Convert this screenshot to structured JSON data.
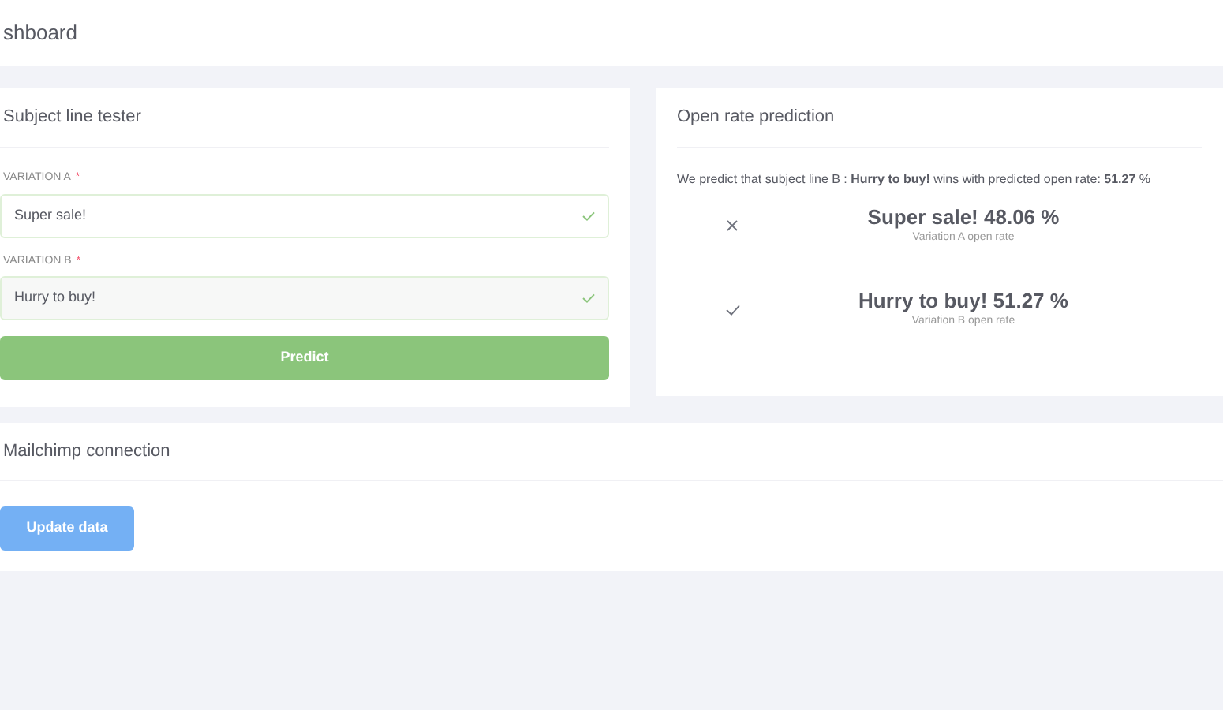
{
  "header": {
    "title": "shboard"
  },
  "tester": {
    "title": "Subject line tester",
    "fields": [
      {
        "label": "VARIATION A",
        "required_mark": "*",
        "value": "Super sale!",
        "valid": true
      },
      {
        "label": "VARIATION B",
        "required_mark": "*",
        "value": "Hurry to buy!",
        "valid": true
      }
    ],
    "button": "Predict"
  },
  "prediction": {
    "title": "Open rate prediction",
    "summary": "We predict that subject line B : **Hurry to buy!** wins with predicted open rate: **51.27** %",
    "results": [
      {
        "kind": "loser",
        "headline": "Super sale! 48.06 %",
        "caption": "Variation A open rate"
      },
      {
        "kind": "winner",
        "headline": "Hurry to buy! 51.27 %",
        "caption": "Variation B open rate"
      }
    ]
  },
  "mailchimp": {
    "title": "Mailchimp connection",
    "button": "Update data"
  }
}
